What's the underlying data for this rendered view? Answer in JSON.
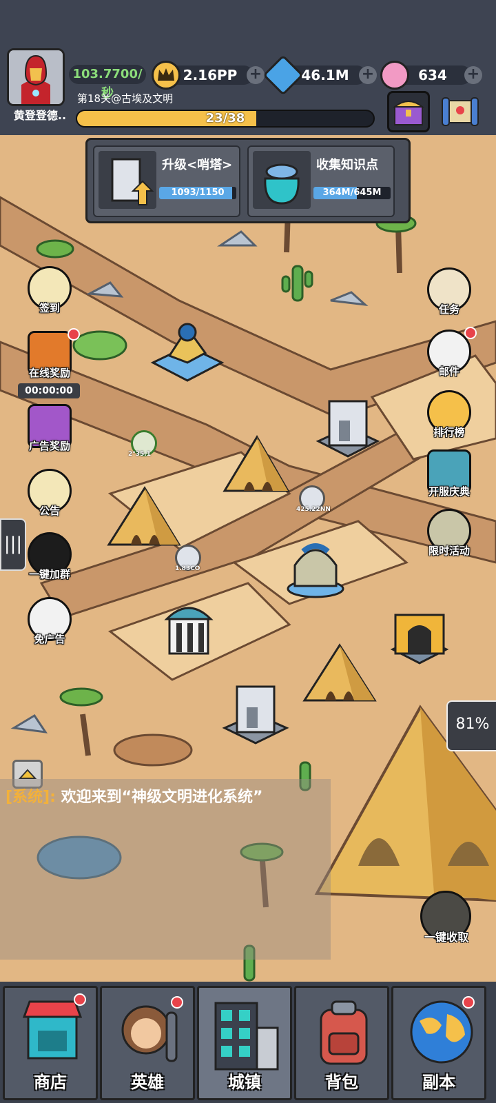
{
  "header": {
    "player_name": "黄登登德..",
    "income_rate": "103.7700/秒",
    "stage_label": "第18关@古埃及文明",
    "progress": {
      "current": 23,
      "total": 38,
      "text": "23/38"
    },
    "resources": [
      {
        "icon": "crown-icon",
        "value": "2.16PP"
      },
      {
        "icon": "spiral-gem-icon",
        "value": "46.1M"
      },
      {
        "icon": "candy-icon",
        "value": "634"
      }
    ],
    "plus_symbol": "+"
  },
  "tasks": [
    {
      "title": "升级<哨塔>",
      "progress_text": "1093/1150",
      "progress_value": 0.95
    },
    {
      "title": "收集知识点",
      "progress_text": "364M/645M",
      "progress_value": 0.56
    }
  ],
  "left_buttons": [
    {
      "label": "签到",
      "icon": "checkin-icon"
    },
    {
      "label": "在线奖励",
      "icon": "chest-icon",
      "timer": "00:00:00"
    },
    {
      "label": "广告奖励",
      "icon": "ad-chest-icon"
    },
    {
      "label": "公告",
      "icon": "megaphone-icon"
    },
    {
      "label": "一键加群",
      "icon": "penguin-icon"
    },
    {
      "label": "免广告",
      "icon": "no-ads-icon"
    }
  ],
  "right_buttons": [
    {
      "label": "任务",
      "icon": "clipboard-icon"
    },
    {
      "label": "邮件",
      "icon": "mail-icon"
    },
    {
      "label": "排行榜",
      "icon": "trophy-icon"
    },
    {
      "label": "开服庆典",
      "icon": "map-icon"
    },
    {
      "label": "限时活动",
      "icon": "party-icon"
    }
  ],
  "map_labels": [
    "2°35.1",
    "425.22NN",
    "1.83CO"
  ],
  "floating_badge": {
    "text": "81%"
  },
  "collect_all": {
    "label": "一键收取"
  },
  "chat": {
    "prefix": "[系统]:",
    "message": " 欢迎来到“神级文明进化系统”"
  },
  "nav": [
    {
      "label": "商店",
      "icon": "shop-icon",
      "dot": true
    },
    {
      "label": "英雄",
      "icon": "caveman-icon",
      "dot": true
    },
    {
      "label": "城镇",
      "icon": "city-icon",
      "dot": false,
      "active": true
    },
    {
      "label": "背包",
      "icon": "backpack-icon",
      "dot": false
    },
    {
      "label": "副本",
      "icon": "globe-icon",
      "dot": true
    }
  ],
  "colors": {
    "accent": "#f5c04a",
    "topbar": "#3e4452",
    "sand": "#dfb47e",
    "badge_red": "#e8434a"
  }
}
